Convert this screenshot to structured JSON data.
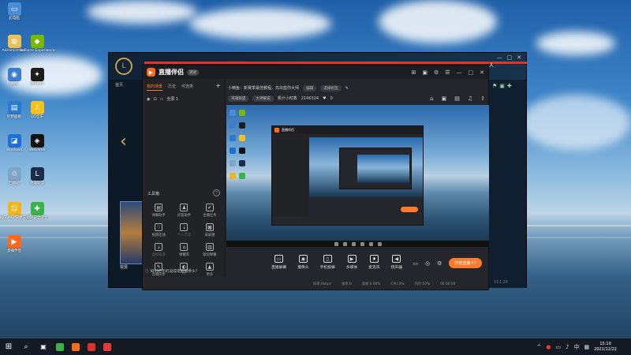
{
  "desktop": {
    "icons": [
      {
        "label": "此电脑",
        "color": "#4b8ed6",
        "glyph": "▭"
      },
      {
        "label": "Administrator",
        "color": "#e8c15a",
        "glyph": "◍"
      },
      {
        "label": "GeForce Experience",
        "color": "#76b900",
        "glyph": "◆"
      },
      {
        "label": "网络",
        "color": "#3c7fd0",
        "glyph": "◉"
      },
      {
        "label": "腾讯QQ",
        "color": "#1c1c1c",
        "glyph": "✦"
      },
      {
        "label": "控制面板",
        "color": "#2a7bd0",
        "glyph": "▤"
      },
      {
        "label": "QQ音乐",
        "color": "#f4c21a",
        "glyph": "♪"
      },
      {
        "label": "Windows",
        "color": "#1d6fd6",
        "glyph": "◪"
      },
      {
        "label": "WeGame",
        "color": "#111",
        "glyph": "◈"
      },
      {
        "label": "回收站",
        "color": "#7fa6c9",
        "glyph": "♲"
      },
      {
        "label": "英雄联盟",
        "color": "#1a2d4a",
        "glyph": "L"
      },
      {
        "label": "JoyToKey 快捷方式",
        "color": "#f2b41d",
        "glyph": "☺"
      },
      {
        "label": "360安全卫士",
        "color": "#3bb24a",
        "glyph": "✚"
      },
      {
        "label": "直播伴侣",
        "color": "#ff6a1a",
        "glyph": "▶"
      }
    ]
  },
  "back_window": {
    "logo": "L",
    "nav_label": "首页",
    "side_text": "人",
    "champion_name": "锐雯",
    "chat_label": "聊天",
    "version": "V11.24",
    "controls": [
      "—",
      "□",
      "✕"
    ]
  },
  "app": {
    "name": "直播伴侣",
    "version_tag": "测试",
    "title_controls": [
      "⊞",
      "▣",
      "⚙",
      "☰",
      "—",
      "□",
      "✕"
    ],
    "left_tabs": [
      "我的场景",
      "历史",
      "可选类",
      "+"
    ],
    "scene": {
      "name": "全屏 1"
    },
    "tools_title": "工具箱",
    "tools_help": "?",
    "tools": [
      {
        "label": "弹幕助手",
        "icon": "▤",
        "dim": false
      },
      {
        "label": "房管助手",
        "icon": "♟",
        "dim": false
      },
      {
        "label": "主播任务",
        "icon": "✔",
        "dim": false
      },
      {
        "label": "视频连线",
        "icon": "♡",
        "dim": false
      },
      {
        "label": "个人活动",
        "icon": "⇣",
        "dim": true
      },
      {
        "label": "录屏播",
        "icon": "▦",
        "dim": false
      },
      {
        "label": "虚拟背景",
        "icon": "⇣",
        "dim": true
      },
      {
        "label": "弹幕库",
        "icon": "⌂",
        "dim": false
      },
      {
        "label": "歌词弹幕",
        "icon": "▥",
        "dim": false
      },
      {
        "label": "云端同步",
        "icon": "✎",
        "dim": false
      },
      {
        "label": "PK",
        "icon": "◐",
        "dim": true
      },
      {
        "label": "更多",
        "icon": "▲",
        "dim": false
      }
    ],
    "bottom_hint": "如何把手机设成电脑摄像头？",
    "room_title": "小楠鱼：新赛季最佳教程，先出蓝你大师",
    "edit_label": "编辑",
    "tag_label": "选择标签",
    "category": "英雄联盟",
    "channel": "大神解说",
    "viewer_label": "累计小时数",
    "viewer_count": "2146324",
    "like_count": "0",
    "right_icons": [
      "⌂",
      "▣",
      "▤",
      "♫",
      "⇪"
    ],
    "toolbar": [
      {
        "label": "直播屏幕",
        "icon": "▭"
      },
      {
        "label": "摄像头",
        "icon": "◉"
      },
      {
        "label": "手机投屏",
        "icon": "▯"
      },
      {
        "label": "多媒体",
        "icon": "▶"
      },
      {
        "label": "麦克风",
        "icon": "♦"
      },
      {
        "label": "扬声器",
        "icon": "◀"
      }
    ],
    "toolbar_right": [
      "▭",
      "◎",
      "⚙"
    ],
    "start_button": "开始直播 F7",
    "status": [
      "码率:0kbps",
      "帧率:0",
      "丢帧:0.00%",
      "CPU:3%",
      "内存:50%",
      "00:00:00"
    ],
    "accent": "#ff7a2a"
  },
  "taskbar": {
    "start_icon": "⊞",
    "search_icon": "⌕",
    "task_view_icon": "▣",
    "apps": [
      {
        "name": "360-icon",
        "color": "#3bb24a"
      },
      {
        "name": "livebroadcast-icon",
        "color": "#ff6a1a"
      },
      {
        "name": "app-icon-red",
        "color": "#d8322b"
      },
      {
        "name": "app-icon-red2",
        "color": "#e83a3a"
      }
    ],
    "tray": [
      "^",
      "●",
      "▭",
      "♪",
      "中",
      "▦"
    ],
    "time": "15:10",
    "date": "2021/12/22"
  }
}
